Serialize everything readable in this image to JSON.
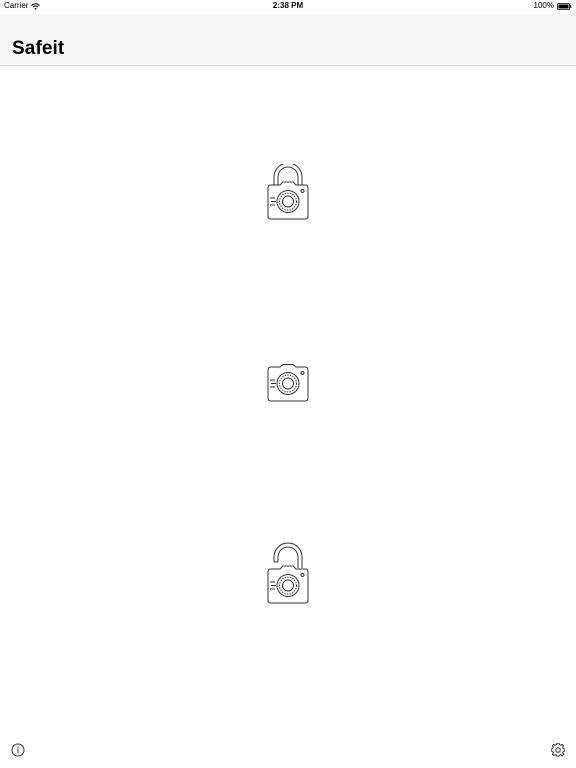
{
  "status_bar": {
    "carrier": "Carrier",
    "time": "2:38 PM",
    "battery": "100%"
  },
  "header": {
    "title": "Safeit"
  },
  "main": {
    "buttons": [
      {
        "icon": "padlock-camera-locked-icon"
      },
      {
        "icon": "camera-icon"
      },
      {
        "icon": "padlock-camera-unlocked-icon"
      }
    ]
  },
  "toolbar": {
    "left_icon": "info-icon",
    "right_icon": "gear-icon"
  },
  "colors": {
    "stroke": "#333333",
    "nav_background": "#f7f7f7",
    "separator": "#d9d9d9"
  }
}
